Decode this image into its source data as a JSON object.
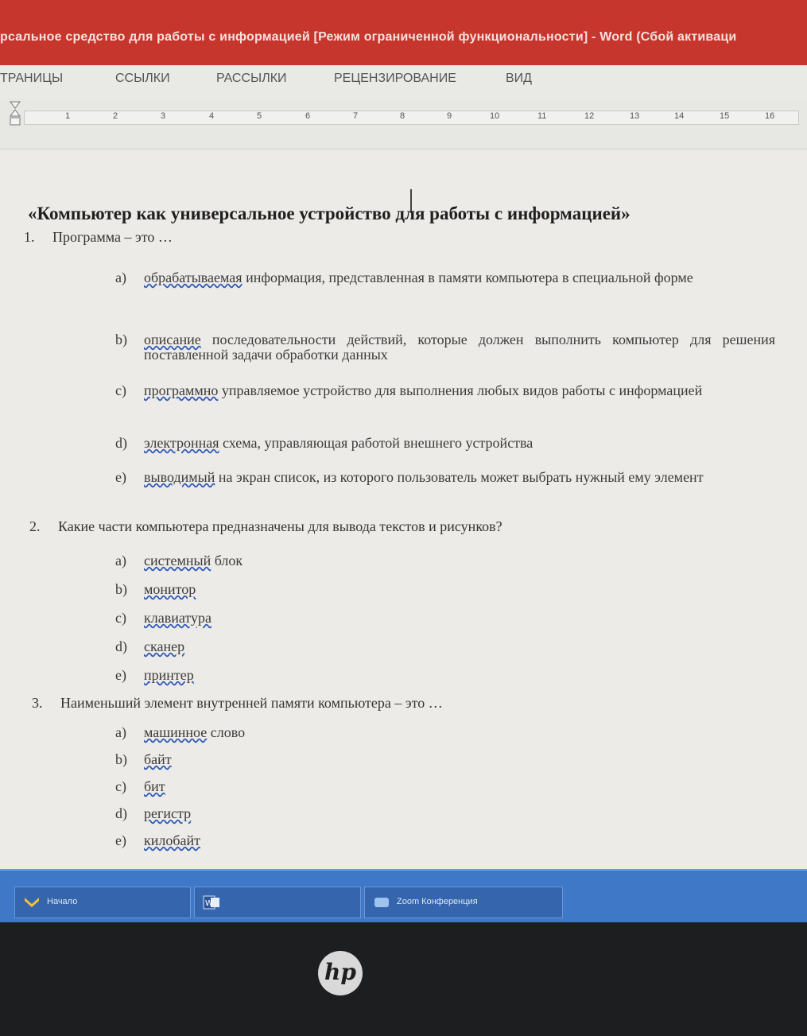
{
  "window": {
    "title": "рсальное средство для работы с информацией [Режим ограниченной функциональности] - Word (Сбой активаци"
  },
  "ribbon": {
    "tabs": [
      "ТРАНИЦЫ",
      "ССЫЛКИ",
      "РАССЫЛКИ",
      "РЕЦЕНЗИРОВАНИЕ",
      "ВИД"
    ]
  },
  "ruler": {
    "numbers": [
      "1",
      "2",
      "3",
      "4",
      "5",
      "6",
      "7",
      "8",
      "9",
      "10",
      "11",
      "12",
      "13",
      "14",
      "15",
      "16"
    ]
  },
  "document": {
    "title": "«Компьютер как универсальное устройство для работы с информацией»",
    "questions": [
      {
        "number": "1.",
        "text": "Программа – это …",
        "options": [
          {
            "letter": "a)",
            "first": "обрабатываемая",
            "rest": " информация, представленная в памяти компьютера в специальной форме"
          },
          {
            "letter": "b)",
            "first": "описание",
            "rest": " последовательности действий, которые должен выполнить компьютер для решения поставленной задачи обработки данных"
          },
          {
            "letter": "c)",
            "first": "программно",
            "rest": " управляемое устройство для выполнения любых видов работы с информацией"
          },
          {
            "letter": "d)",
            "first": "электронная",
            "rest": " схема, управляющая работой внешнего устройства"
          },
          {
            "letter": "e)",
            "first": "выводимый",
            "rest": " на экран список, из которого пользователь может выбрать нужный ему элемент"
          }
        ]
      },
      {
        "number": "2.",
        "text": "Какие части компьютера предназначены для вывода текстов и рисунков?",
        "options": [
          {
            "letter": "a)",
            "first": "системный",
            "rest": " блок"
          },
          {
            "letter": "b)",
            "first": "монитор",
            "rest": ""
          },
          {
            "letter": "c)",
            "first": "клавиатура",
            "rest": ""
          },
          {
            "letter": "d)",
            "first": "сканер",
            "rest": ""
          },
          {
            "letter": "e)",
            "first": "принтер",
            "rest": ""
          }
        ]
      },
      {
        "number": "3.",
        "text": "Наименьший элемент внутренней памяти компьютера – это …",
        "options": [
          {
            "letter": "a)",
            "first": "машинное",
            "rest": " слово"
          },
          {
            "letter": "b)",
            "first": "байт",
            "rest": ""
          },
          {
            "letter": "c)",
            "first": "бит",
            "rest": ""
          },
          {
            "letter": "d)",
            "first": "регистр",
            "rest": ""
          },
          {
            "letter": "e)",
            "first": "килобайт",
            "rest": ""
          }
        ]
      }
    ]
  },
  "taskbar": {
    "items": [
      {
        "icon": "yandex-icon",
        "label": "Начало"
      },
      {
        "icon": "word-icon",
        "label": ""
      },
      {
        "icon": "conference-icon",
        "label": "Zoom Конференция"
      }
    ]
  },
  "brand": {
    "logo": "hp"
  },
  "colors": {
    "titlebar": "#c6362c",
    "taskbar": "#3e78c7",
    "spellcheck": "#2e58b8"
  }
}
